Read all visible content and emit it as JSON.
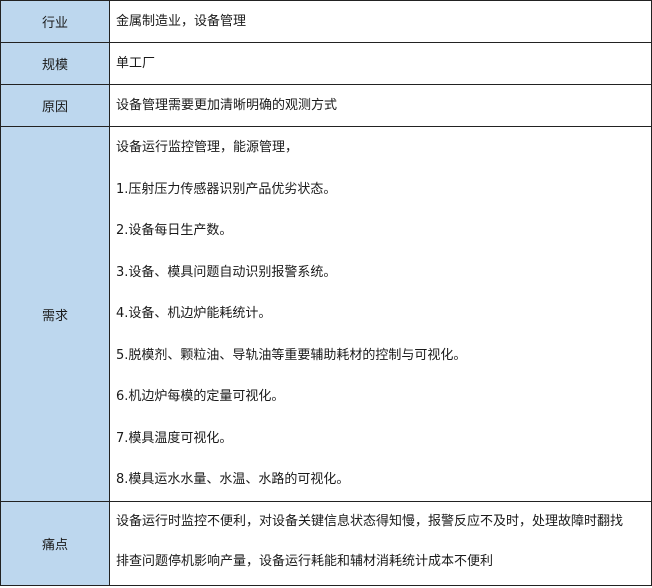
{
  "rows": [
    {
      "label": "行业",
      "lines": [
        "金属制造业，设备管理"
      ]
    },
    {
      "label": "规模",
      "lines": [
        "单工厂"
      ]
    },
    {
      "label": "原因",
      "lines": [
        "设备管理需要更加清晰明确的观测方式"
      ]
    },
    {
      "label": "需求",
      "lines": [
        "设备运行监控管理，能源管理，",
        "1.压射压力传感器识别产品优劣状态。",
        "2.设备每日生产数。",
        "3.设备、模具问题自动识别报警系统。",
        "4.设备、机边炉能耗统计。",
        "5.脱模剂、颗粒油、导轨油等重要辅助耗材的控制与可视化。",
        "6.机边炉每模的定量可视化。",
        "7.模具温度可视化。",
        "8.模具运水水量、水温、水路的可视化。"
      ]
    },
    {
      "label": "痛点",
      "lines": [
        "设备运行时监控不便利，对设备关键信息状态得知慢，报警反应不及时，处理故障时翻找",
        "排查问题停机影响产量，设备运行耗能和辅材消耗统计成本不便利"
      ]
    }
  ]
}
